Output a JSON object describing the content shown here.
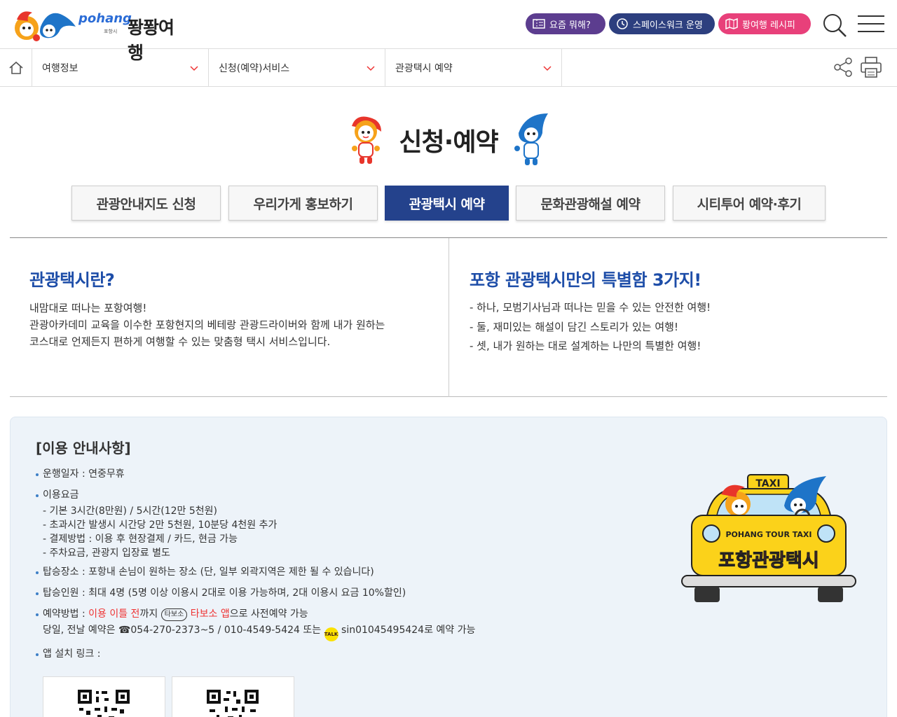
{
  "header": {
    "logo_text": "퐝퐝여행",
    "logo_en": "pohang",
    "logo_sub": "포항시",
    "pills": [
      "요즘 뭐해?",
      "스페이스워크 운영",
      "퐝여행 레시피"
    ]
  },
  "breadcrumb": [
    "여행정보",
    "신청(예약)서비스",
    "관광택시 예약"
  ],
  "page_title": "신청·예약",
  "tabs": [
    {
      "label": "관광안내지도 신청"
    },
    {
      "label": "우리가게 홍보하기"
    },
    {
      "label": "관광택시 예약"
    },
    {
      "label": "문화관광해설 예약"
    },
    {
      "label": "시티투어 예약·후기"
    }
  ],
  "left_col": {
    "heading": "관광택시란?",
    "lines": [
      "내맘대로 떠나는 포항여행!",
      "관광아카데미 교육을 이수한 포항현지의 베테랑 관광드라이버와 함께 내가 원하는",
      "코스대로 언제든지 편하게 여행할 수 있는 맞춤형 택시 서비스입니다."
    ]
  },
  "right_col": {
    "heading": "포항 관광택시만의 특별함 3가지!",
    "lines": [
      "- 하나, 모범기사님과 떠나는 믿을 수 있는 안전한 여행!",
      "- 둘, 재미있는 해설이 담긴 스토리가 있는 여행!",
      "- 셋, 내가 원하는 대로 설계하는 나만의 특별한 여행!"
    ]
  },
  "info": {
    "title": "[이용 안내사항]",
    "schedule": "운행일자 : 연중무휴",
    "fee_title": "이용요금",
    "fee_lines": [
      "- 기본 3시간(8만원) / 5시간(12만 5천원)",
      "- 초과시간 발생시 시간당 2만 5천원, 10분당 4천원 추가",
      "- 결제방법 : 이용 후 현장결제 / 카드, 현금 가능",
      "- 주차요금, 관광지 입장료 별도"
    ],
    "pickup": "탑승장소 : 포항내 손님이 원하는 장소 (단, 일부 외곽지역은 제한 될 수 있습니다)",
    "capacity": "탑승인원 : 최대 4명 (5명 이상 이용시 2대로 이용 가능하며, 2대 이용시 요금 10%할인)",
    "reserve_label": "예약방법 : ",
    "reserve_red1": "이용 이틀 전",
    "reserve_mid": "까지 ",
    "tabosu_chip": "타보소",
    "reserve_red2": "타보소 앱",
    "reserve_end": "으로 사전예약 가능",
    "sameday": "당일, 전날 예약은 ☎054-270-2373~5 / 010-4549-5424 또는 ",
    "kakao_label": "TALK",
    "kakao_id": "sin01045495424로 예약 가능",
    "app_link": "앱 설치 링크 :"
  },
  "taxi_image": {
    "sign": "TAXI",
    "plate_en": "POHANG TOUR TAXI",
    "plate_ko": "포항관광택시"
  },
  "colors": {
    "primary": "#24428c",
    "heading_blue": "#1d4da8",
    "pill_purple": "#5c3d8f",
    "pill_navy": "#2d3f7f",
    "pill_pink": "#e8407a",
    "info_bg": "#edf3f9",
    "red": "#e33333"
  }
}
